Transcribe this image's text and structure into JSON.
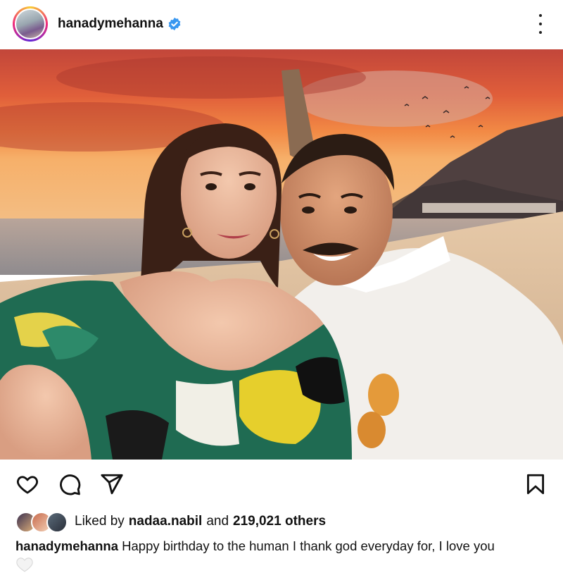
{
  "post": {
    "username": "hanadymehanna",
    "verified": true,
    "caption": "Happy birthday to the human I thank god everyday for, I love you"
  },
  "likes": {
    "prefix": "Liked by",
    "user": "nadaa.nabil",
    "joiner": "and",
    "count": "219,021 others"
  },
  "icons": {
    "header": [
      "avatar",
      "verified-badge-icon",
      "more-options-icon"
    ],
    "actions": [
      "heart-icon",
      "comment-icon",
      "share-icon",
      "bookmark-icon"
    ],
    "caption_end": "white-heart-emoji"
  },
  "colors": {
    "verified_blue": "#3897f0",
    "text": "#111111",
    "sunset_orange": "#f07a3a"
  }
}
